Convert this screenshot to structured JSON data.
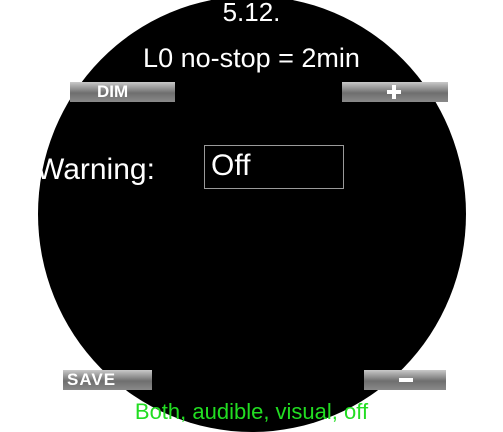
{
  "header": {
    "menu_number": "5.12.",
    "title": "L0 no-stop = 2min"
  },
  "softkeys": {
    "top_left": "DIM",
    "top_right_icon": "plus-icon",
    "bottom_left": "SAVE",
    "bottom_right_icon": "minus-icon"
  },
  "setting": {
    "label": "Warning:",
    "value": "Off"
  },
  "hint": "Both, audible, visual, off",
  "colors": {
    "background": "#000000",
    "text": "#ffffff",
    "hint": "#22dd22",
    "value_border": "#9a9a9a"
  }
}
